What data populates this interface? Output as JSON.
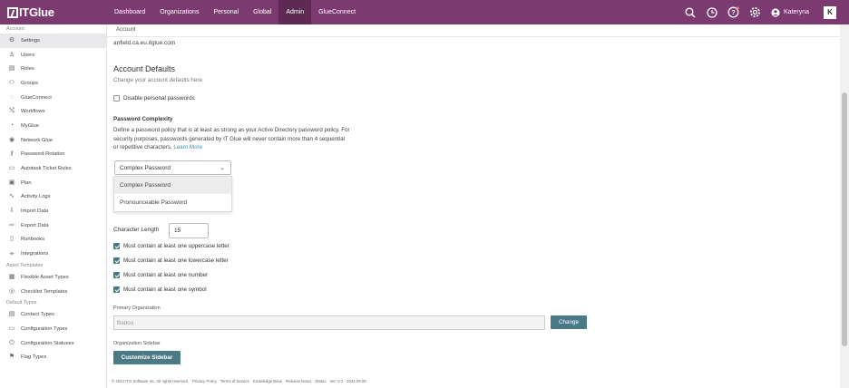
{
  "app": {
    "logo_text": "ITGlue",
    "nav": [
      "Dashboard",
      "Organizations",
      "Personal",
      "Global",
      "Admin",
      "GlueConnect"
    ],
    "active_nav": "Admin",
    "user_name": "Kateryna",
    "user_badge": "K"
  },
  "breadcrumb": "Account",
  "sidebar": {
    "sections": [
      {
        "title": "Account",
        "items": [
          {
            "label": "Settings",
            "icon": "gear-icon",
            "glyph": "⚙",
            "active": true
          },
          {
            "label": "Users",
            "icon": "user-icon",
            "glyph": "♙",
            "active": false
          },
          {
            "label": "Roles",
            "icon": "roles-icon",
            "glyph": "▤",
            "active": false
          },
          {
            "label": "Groups",
            "icon": "groups-icon",
            "glyph": "⚇",
            "active": false
          },
          {
            "label": "GlueConnect",
            "icon": "glueconnect-icon",
            "glyph": "◌",
            "active": false
          },
          {
            "label": "Workflows",
            "icon": "workflows-icon",
            "glyph": "⤭",
            "active": false
          },
          {
            "label": "MyGlue",
            "icon": "myglue-icon",
            "glyph": "◔",
            "active": false
          },
          {
            "label": "Network Glue",
            "icon": "eye-icon",
            "glyph": "◉",
            "active": false
          },
          {
            "label": "Password Rotation",
            "icon": "key-icon",
            "glyph": "⚷",
            "active": false
          },
          {
            "label": "Autotask Ticket Rules",
            "icon": "ticket-icon",
            "glyph": "▭",
            "active": false
          },
          {
            "label": "Plan",
            "icon": "plan-icon",
            "glyph": "▣",
            "active": false
          },
          {
            "label": "Activity Logs",
            "icon": "activity-icon",
            "glyph": "∿",
            "active": false
          },
          {
            "label": "Import Data",
            "icon": "import-icon",
            "glyph": "⇩",
            "active": false
          },
          {
            "label": "Export Data",
            "icon": "export-icon",
            "glyph": "⇨",
            "active": false
          },
          {
            "label": "Runbooks",
            "icon": "runbook-icon",
            "glyph": "▯",
            "active": false
          },
          {
            "label": "Integrations",
            "icon": "integrations-icon",
            "glyph": "⌯",
            "active": false
          }
        ]
      },
      {
        "title": "Asset Templates",
        "items": [
          {
            "label": "Flexible Asset Types",
            "icon": "flexible-asset-icon",
            "glyph": "▦",
            "active": false
          },
          {
            "label": "Checklist Templates",
            "icon": "checklist-icon",
            "glyph": "◎",
            "active": false
          }
        ]
      },
      {
        "title": "Default Types",
        "items": [
          {
            "label": "Contact Types",
            "icon": "contact-icon",
            "glyph": "▤",
            "active": false
          },
          {
            "label": "Configuration Types",
            "icon": "monitor-icon",
            "glyph": "▭",
            "active": false
          },
          {
            "label": "Configuration Statuses",
            "icon": "power-icon",
            "glyph": "⏻",
            "active": false
          },
          {
            "label": "Flag Types",
            "icon": "flag-icon",
            "glyph": "⚑",
            "active": false
          }
        ]
      }
    ]
  },
  "main": {
    "domain_text": "anfield.ca.eu.itglue.com",
    "defaults_title": "Account Defaults",
    "defaults_subtitle": "Change your account defaults here.",
    "disable_personal": {
      "label": "Disable personal passwords",
      "checked": false
    },
    "complexity_title": "Password Complexity",
    "complexity_desc": "Define a password policy that is at least as strong as your Active Directory password policy. For security purposes, passwords generated by IT Glue will never contain more than 4 sequential or repetitive characters.",
    "learn_more": "Learn More",
    "select_value": "Complex Password",
    "dropdown_options": [
      "Complex Password",
      "Pronounceable Password"
    ],
    "char_length_label": "Character Length",
    "char_length_value": "15",
    "rules": [
      {
        "label": "Must contain at least one uppercase letter",
        "checked": true
      },
      {
        "label": "Must contain at least one lowercase letter",
        "checked": true
      },
      {
        "label": "Must contain at least one number",
        "checked": true
      },
      {
        "label": "Must contain at least one symbol",
        "checked": true
      }
    ],
    "primary_org_label": "Primary Organization",
    "primary_org_value": "Badoo",
    "change_button": "Change",
    "org_sidebar_label": "Organization Sidebar",
    "customize_button": "Customize Sidebar"
  },
  "footer": {
    "copyright": "© 2024 ITG Software Inc. All rights reserved.",
    "links": [
      "Privacy Policy",
      "Terms of Service",
      "Knowledge Base",
      "Release Notes",
      "Status"
    ],
    "version": "Ver: 0.1 - 2024.09.08"
  },
  "colors": {
    "topbar": "#7b3a70",
    "active_nav": "#5e2a55",
    "accent_button": "#4a7a86",
    "link": "#4a8aa8"
  }
}
